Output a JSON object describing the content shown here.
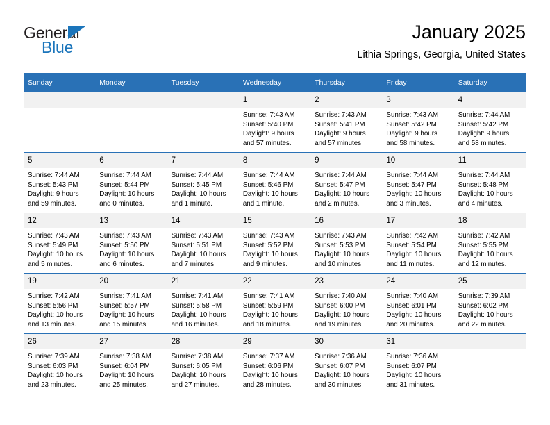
{
  "brand": {
    "name_dark": "General",
    "name_blue": "Blue",
    "accent_color": "#1b75bb",
    "header_color": "#2971b6"
  },
  "header": {
    "title": "January 2025",
    "subtitle": "Lithia Springs, Georgia, United States"
  },
  "calendar": {
    "weekday_headers": [
      "Sunday",
      "Monday",
      "Tuesday",
      "Wednesday",
      "Thursday",
      "Friday",
      "Saturday"
    ],
    "weeks": [
      [
        {
          "day": "",
          "sunrise": "",
          "sunset": "",
          "daylight_line1": "",
          "daylight_line2": ""
        },
        {
          "day": "",
          "sunrise": "",
          "sunset": "",
          "daylight_line1": "",
          "daylight_line2": ""
        },
        {
          "day": "",
          "sunrise": "",
          "sunset": "",
          "daylight_line1": "",
          "daylight_line2": ""
        },
        {
          "day": "1",
          "sunrise": "Sunrise: 7:43 AM",
          "sunset": "Sunset: 5:40 PM",
          "daylight_line1": "Daylight: 9 hours",
          "daylight_line2": "and 57 minutes."
        },
        {
          "day": "2",
          "sunrise": "Sunrise: 7:43 AM",
          "sunset": "Sunset: 5:41 PM",
          "daylight_line1": "Daylight: 9 hours",
          "daylight_line2": "and 57 minutes."
        },
        {
          "day": "3",
          "sunrise": "Sunrise: 7:43 AM",
          "sunset": "Sunset: 5:42 PM",
          "daylight_line1": "Daylight: 9 hours",
          "daylight_line2": "and 58 minutes."
        },
        {
          "day": "4",
          "sunrise": "Sunrise: 7:44 AM",
          "sunset": "Sunset: 5:42 PM",
          "daylight_line1": "Daylight: 9 hours",
          "daylight_line2": "and 58 minutes."
        }
      ],
      [
        {
          "day": "5",
          "sunrise": "Sunrise: 7:44 AM",
          "sunset": "Sunset: 5:43 PM",
          "daylight_line1": "Daylight: 9 hours",
          "daylight_line2": "and 59 minutes."
        },
        {
          "day": "6",
          "sunrise": "Sunrise: 7:44 AM",
          "sunset": "Sunset: 5:44 PM",
          "daylight_line1": "Daylight: 10 hours",
          "daylight_line2": "and 0 minutes."
        },
        {
          "day": "7",
          "sunrise": "Sunrise: 7:44 AM",
          "sunset": "Sunset: 5:45 PM",
          "daylight_line1": "Daylight: 10 hours",
          "daylight_line2": "and 1 minute."
        },
        {
          "day": "8",
          "sunrise": "Sunrise: 7:44 AM",
          "sunset": "Sunset: 5:46 PM",
          "daylight_line1": "Daylight: 10 hours",
          "daylight_line2": "and 1 minute."
        },
        {
          "day": "9",
          "sunrise": "Sunrise: 7:44 AM",
          "sunset": "Sunset: 5:47 PM",
          "daylight_line1": "Daylight: 10 hours",
          "daylight_line2": "and 2 minutes."
        },
        {
          "day": "10",
          "sunrise": "Sunrise: 7:44 AM",
          "sunset": "Sunset: 5:47 PM",
          "daylight_line1": "Daylight: 10 hours",
          "daylight_line2": "and 3 minutes."
        },
        {
          "day": "11",
          "sunrise": "Sunrise: 7:44 AM",
          "sunset": "Sunset: 5:48 PM",
          "daylight_line1": "Daylight: 10 hours",
          "daylight_line2": "and 4 minutes."
        }
      ],
      [
        {
          "day": "12",
          "sunrise": "Sunrise: 7:43 AM",
          "sunset": "Sunset: 5:49 PM",
          "daylight_line1": "Daylight: 10 hours",
          "daylight_line2": "and 5 minutes."
        },
        {
          "day": "13",
          "sunrise": "Sunrise: 7:43 AM",
          "sunset": "Sunset: 5:50 PM",
          "daylight_line1": "Daylight: 10 hours",
          "daylight_line2": "and 6 minutes."
        },
        {
          "day": "14",
          "sunrise": "Sunrise: 7:43 AM",
          "sunset": "Sunset: 5:51 PM",
          "daylight_line1": "Daylight: 10 hours",
          "daylight_line2": "and 7 minutes."
        },
        {
          "day": "15",
          "sunrise": "Sunrise: 7:43 AM",
          "sunset": "Sunset: 5:52 PM",
          "daylight_line1": "Daylight: 10 hours",
          "daylight_line2": "and 9 minutes."
        },
        {
          "day": "16",
          "sunrise": "Sunrise: 7:43 AM",
          "sunset": "Sunset: 5:53 PM",
          "daylight_line1": "Daylight: 10 hours",
          "daylight_line2": "and 10 minutes."
        },
        {
          "day": "17",
          "sunrise": "Sunrise: 7:42 AM",
          "sunset": "Sunset: 5:54 PM",
          "daylight_line1": "Daylight: 10 hours",
          "daylight_line2": "and 11 minutes."
        },
        {
          "day": "18",
          "sunrise": "Sunrise: 7:42 AM",
          "sunset": "Sunset: 5:55 PM",
          "daylight_line1": "Daylight: 10 hours",
          "daylight_line2": "and 12 minutes."
        }
      ],
      [
        {
          "day": "19",
          "sunrise": "Sunrise: 7:42 AM",
          "sunset": "Sunset: 5:56 PM",
          "daylight_line1": "Daylight: 10 hours",
          "daylight_line2": "and 13 minutes."
        },
        {
          "day": "20",
          "sunrise": "Sunrise: 7:41 AM",
          "sunset": "Sunset: 5:57 PM",
          "daylight_line1": "Daylight: 10 hours",
          "daylight_line2": "and 15 minutes."
        },
        {
          "day": "21",
          "sunrise": "Sunrise: 7:41 AM",
          "sunset": "Sunset: 5:58 PM",
          "daylight_line1": "Daylight: 10 hours",
          "daylight_line2": "and 16 minutes."
        },
        {
          "day": "22",
          "sunrise": "Sunrise: 7:41 AM",
          "sunset": "Sunset: 5:59 PM",
          "daylight_line1": "Daylight: 10 hours",
          "daylight_line2": "and 18 minutes."
        },
        {
          "day": "23",
          "sunrise": "Sunrise: 7:40 AM",
          "sunset": "Sunset: 6:00 PM",
          "daylight_line1": "Daylight: 10 hours",
          "daylight_line2": "and 19 minutes."
        },
        {
          "day": "24",
          "sunrise": "Sunrise: 7:40 AM",
          "sunset": "Sunset: 6:01 PM",
          "daylight_line1": "Daylight: 10 hours",
          "daylight_line2": "and 20 minutes."
        },
        {
          "day": "25",
          "sunrise": "Sunrise: 7:39 AM",
          "sunset": "Sunset: 6:02 PM",
          "daylight_line1": "Daylight: 10 hours",
          "daylight_line2": "and 22 minutes."
        }
      ],
      [
        {
          "day": "26",
          "sunrise": "Sunrise: 7:39 AM",
          "sunset": "Sunset: 6:03 PM",
          "daylight_line1": "Daylight: 10 hours",
          "daylight_line2": "and 23 minutes."
        },
        {
          "day": "27",
          "sunrise": "Sunrise: 7:38 AM",
          "sunset": "Sunset: 6:04 PM",
          "daylight_line1": "Daylight: 10 hours",
          "daylight_line2": "and 25 minutes."
        },
        {
          "day": "28",
          "sunrise": "Sunrise: 7:38 AM",
          "sunset": "Sunset: 6:05 PM",
          "daylight_line1": "Daylight: 10 hours",
          "daylight_line2": "and 27 minutes."
        },
        {
          "day": "29",
          "sunrise": "Sunrise: 7:37 AM",
          "sunset": "Sunset: 6:06 PM",
          "daylight_line1": "Daylight: 10 hours",
          "daylight_line2": "and 28 minutes."
        },
        {
          "day": "30",
          "sunrise": "Sunrise: 7:36 AM",
          "sunset": "Sunset: 6:07 PM",
          "daylight_line1": "Daylight: 10 hours",
          "daylight_line2": "and 30 minutes."
        },
        {
          "day": "31",
          "sunrise": "Sunrise: 7:36 AM",
          "sunset": "Sunset: 6:07 PM",
          "daylight_line1": "Daylight: 10 hours",
          "daylight_line2": "and 31 minutes."
        },
        {
          "day": "",
          "sunrise": "",
          "sunset": "",
          "daylight_line1": "",
          "daylight_line2": ""
        }
      ]
    ]
  }
}
